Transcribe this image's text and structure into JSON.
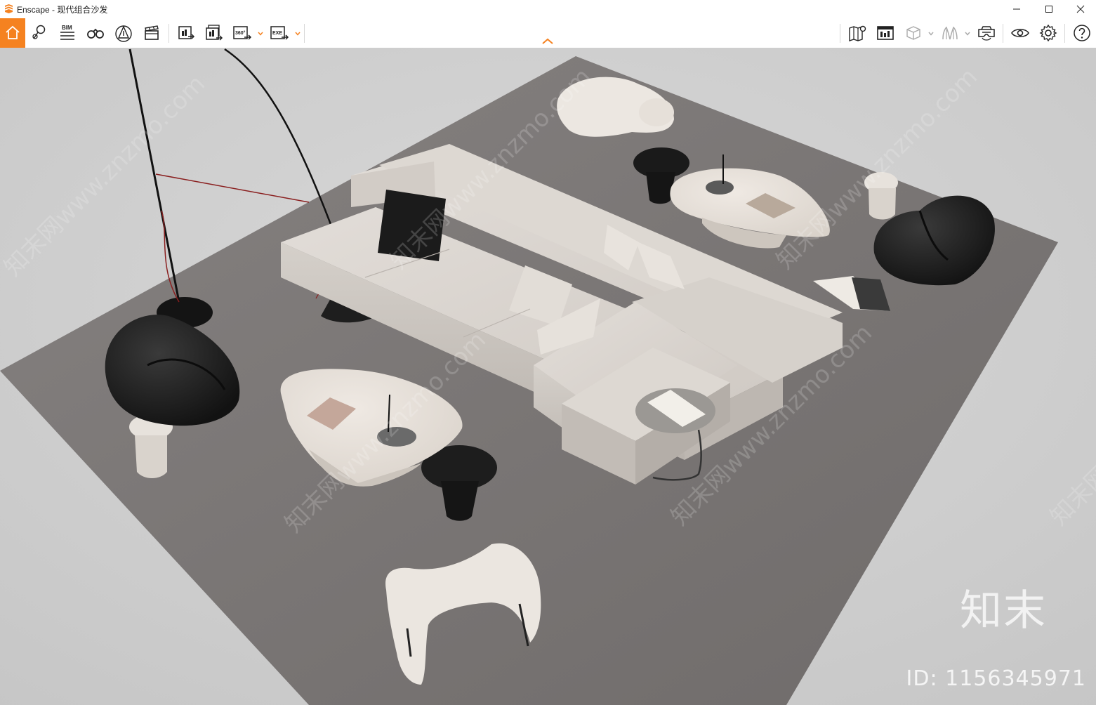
{
  "window": {
    "title": "Enscape - 现代组合沙发",
    "controls": [
      "minimize",
      "maximize",
      "close"
    ]
  },
  "toolbar": {
    "left_buttons": [
      {
        "name": "home-icon",
        "active": true
      },
      {
        "name": "location-pin-icon"
      },
      {
        "name": "bim-icon",
        "label": "BIM"
      },
      {
        "name": "binoculars-icon"
      },
      {
        "name": "compass-triangle-icon"
      },
      {
        "name": "clapperboard-icon"
      },
      {
        "name": "render-screenshot-icon"
      },
      {
        "name": "batch-render-icon"
      },
      {
        "name": "panorama-360-icon",
        "label": "360°",
        "has_dropdown": true
      },
      {
        "name": "export-exe-icon",
        "label": "EXE",
        "has_dropdown": true
      }
    ],
    "right_buttons": [
      {
        "name": "map-pin-icon"
      },
      {
        "name": "asset-library-icon"
      },
      {
        "name": "cube-icon",
        "has_dropdown": true
      },
      {
        "name": "material-icon",
        "has_dropdown": true
      },
      {
        "name": "vr-headset-icon"
      },
      {
        "name": "eye-icon"
      },
      {
        "name": "settings-gear-icon"
      },
      {
        "name": "help-icon"
      }
    ],
    "accent_color": "#f58220"
  },
  "viewport": {
    "watermark_brand": "知末",
    "watermark_id": "ID: 1156345971",
    "diagonal_watermark": "知末网www.znzmo.com",
    "scene_description_colors": {
      "floor": "#cfcfcf",
      "rug": "#7a7674",
      "sofa": "#d9d4cf",
      "dark_furniture": "#1f1f1f",
      "light_furniture": "#e9e4de"
    }
  }
}
